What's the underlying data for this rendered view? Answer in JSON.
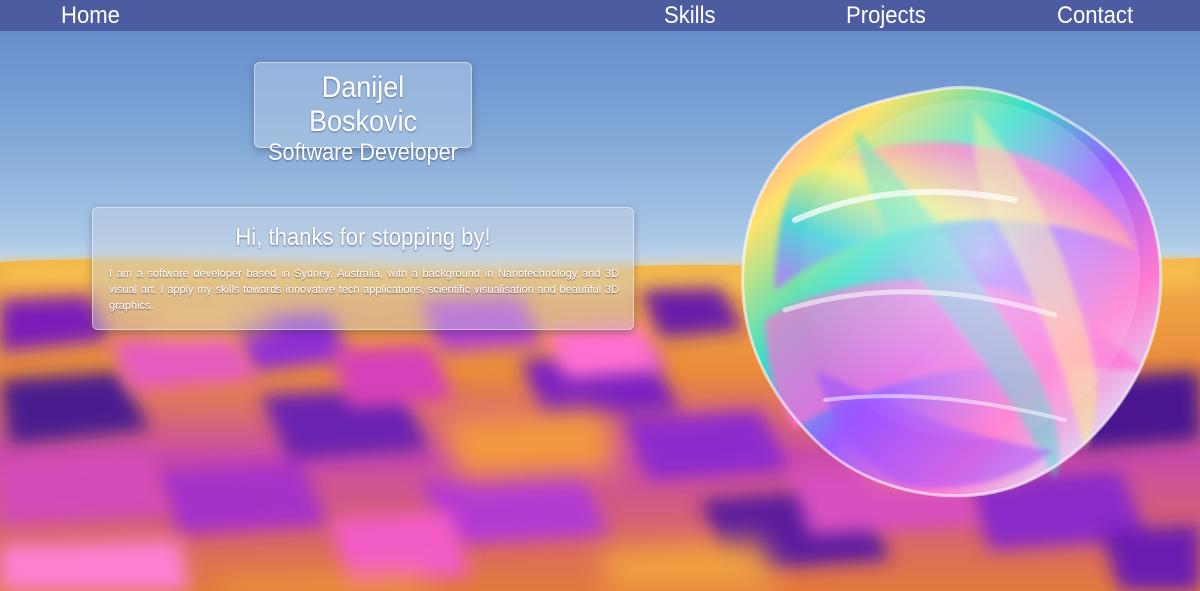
{
  "nav": {
    "home": "Home",
    "skills": "Skills",
    "projects": "Projects",
    "contact": "Contact"
  },
  "hero": {
    "name": "Danijel Boskovic",
    "role": "Software Developer"
  },
  "intro": {
    "heading": "Hi, thanks for stopping by!",
    "body": "I am a software developer based in Sydney, Australia, with a background in Nanotechnology and 3D visual art. I apply my skills towards innovative tech applications, scientific visualisation and beautiful 3D graphics."
  },
  "colors": {
    "navbar": "#4a5596",
    "sky_top": "#5f86c8",
    "sky_bottom": "#c6d9ea",
    "ground_orange": "#f0a040",
    "ground_purple": "#8a2fd0",
    "ground_magenta": "#d040b0"
  }
}
